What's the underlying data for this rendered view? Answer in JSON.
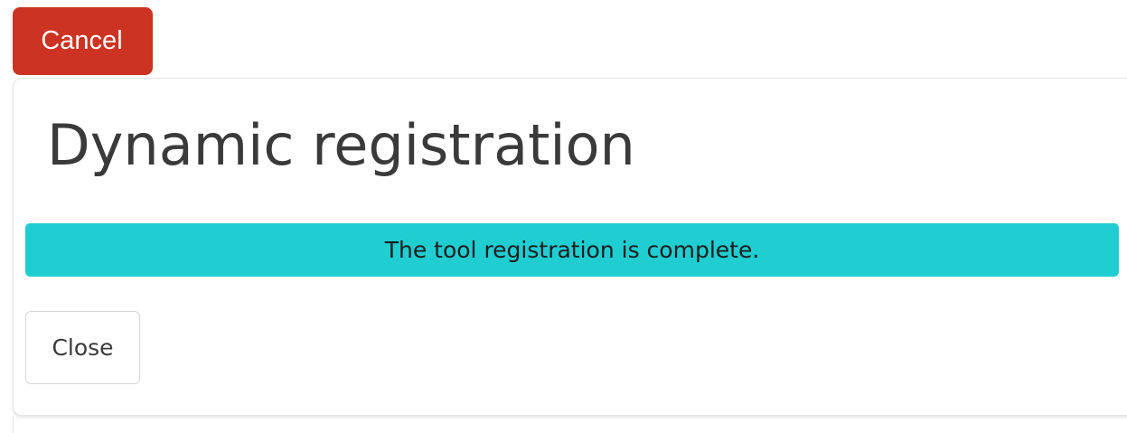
{
  "header": {
    "cancel_label": "Cancel"
  },
  "dialog": {
    "title": "Dynamic registration",
    "alert_message": "The tool registration is complete.",
    "close_label": "Close"
  },
  "colors": {
    "cancel_button": "#cc3322",
    "alert_background": "#20cdd1",
    "title_text": "#3a3a3a"
  }
}
